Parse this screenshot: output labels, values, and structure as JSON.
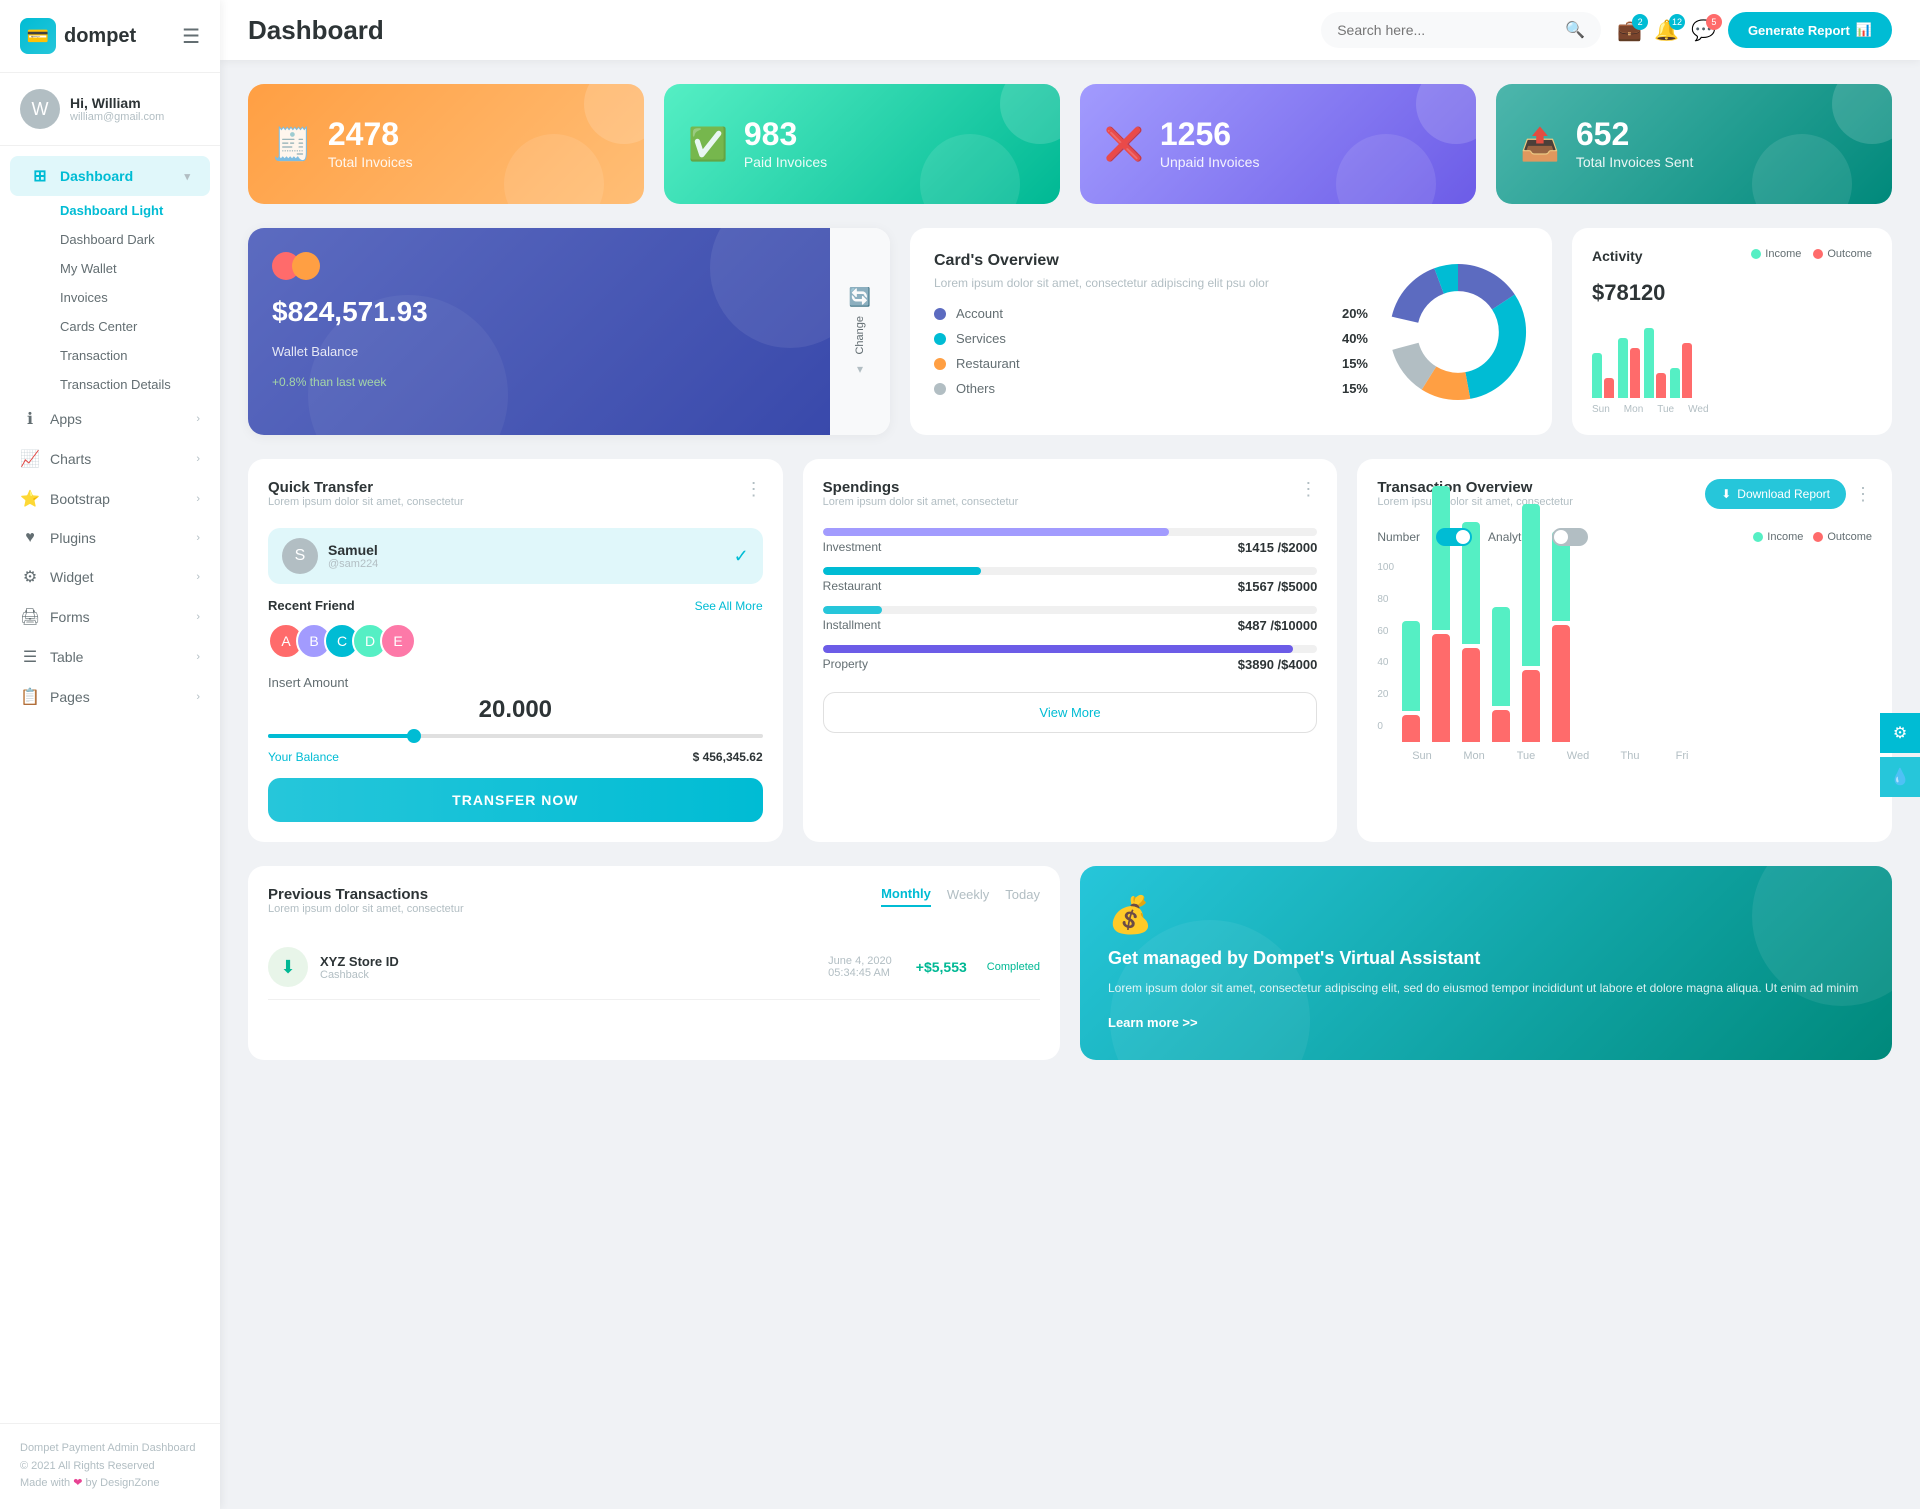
{
  "brand": {
    "name": "dompet",
    "logo_emoji": "💼"
  },
  "header": {
    "title": "Dashboard",
    "search_placeholder": "Search here...",
    "generate_btn": "Generate Report",
    "icons": {
      "wallet_badge": "2",
      "bell_badge": "12",
      "chat_badge": "5"
    }
  },
  "user": {
    "greeting": "Hi, William",
    "email": "william@gmail.com",
    "avatar_letter": "W"
  },
  "sidebar": {
    "dashboard_label": "Dashboard",
    "sub_items": [
      {
        "label": "Dashboard Light",
        "active": true
      },
      {
        "label": "Dashboard Dark",
        "active": false
      },
      {
        "label": "My Wallet",
        "active": false
      },
      {
        "label": "Invoices",
        "active": false
      },
      {
        "label": "Cards Center",
        "active": false
      },
      {
        "label": "Transaction",
        "active": false
      },
      {
        "label": "Transaction Details",
        "active": false
      }
    ],
    "nav_items": [
      {
        "label": "Apps",
        "icon": "ℹ️"
      },
      {
        "label": "Charts",
        "icon": "📊"
      },
      {
        "label": "Bootstrap",
        "icon": "⭐"
      },
      {
        "label": "Plugins",
        "icon": "❤️"
      },
      {
        "label": "Widget",
        "icon": "⚙️"
      },
      {
        "label": "Forms",
        "icon": "🖨️"
      },
      {
        "label": "Table",
        "icon": "☰"
      },
      {
        "label": "Pages",
        "icon": "📋"
      }
    ],
    "footer": {
      "line1": "Dompet Payment Admin Dashboard",
      "line2": "© 2021 All Rights Reserved",
      "line3": "Made with ❤ by DesignZone"
    }
  },
  "stats": [
    {
      "number": "2478",
      "label": "Total Invoices",
      "color": "orange",
      "icon": "🧾"
    },
    {
      "number": "983",
      "label": "Paid Invoices",
      "color": "green",
      "icon": "✅"
    },
    {
      "number": "1256",
      "label": "Unpaid Invoices",
      "color": "purple",
      "icon": "❌"
    },
    {
      "number": "652",
      "label": "Total Invoices Sent",
      "color": "teal",
      "icon": "📤"
    }
  ],
  "wallet_card": {
    "amount": "$824,571.93",
    "label": "Wallet Balance",
    "change": "+0.8% than last week",
    "change_btn": "Change"
  },
  "card_overview": {
    "title": "Card's Overview",
    "subtitle": "Lorem ipsum dolor sit amet, consectetur adipiscing elit psu olor",
    "items": [
      {
        "label": "Account",
        "pct": "20%",
        "color": "#5c6bc0"
      },
      {
        "label": "Services",
        "pct": "40%",
        "color": "#00bcd4"
      },
      {
        "label": "Restaurant",
        "pct": "15%",
        "color": "#ff9f43"
      },
      {
        "label": "Others",
        "pct": "15%",
        "color": "#b2bec3"
      }
    ]
  },
  "activity": {
    "title": "Activity",
    "amount": "$78120",
    "legend_income": "Income",
    "legend_outcome": "Outcome",
    "bars": [
      {
        "day": "Sun",
        "income": 45,
        "outcome": 20
      },
      {
        "day": "Mon",
        "income": 60,
        "outcome": 50
      },
      {
        "day": "Tue",
        "income": 70,
        "outcome": 25
      },
      {
        "day": "Wed",
        "income": 30,
        "outcome": 55
      }
    ]
  },
  "quick_transfer": {
    "title": "Quick Transfer",
    "subtitle": "Lorem ipsum dolor sit amet, consectetur",
    "user": {
      "name": "Samuel",
      "handle": "@sam224",
      "avatar_letter": "S"
    },
    "recent_label": "Recent Friend",
    "see_all": "See All More",
    "friends": [
      "A",
      "B",
      "C",
      "D",
      "E"
    ],
    "insert_label": "Insert Amount",
    "amount": "20.000",
    "balance_label": "Your Balance",
    "balance_amount": "$ 456,345.62",
    "slider_pct": 30,
    "transfer_btn": "TRANSFER NOW"
  },
  "spendings": {
    "title": "Spendings",
    "subtitle": "Lorem ipsum dolor sit amet, consectetur",
    "items": [
      {
        "label": "Investment",
        "amount": "$1415",
        "max": "$2000",
        "pct": 70,
        "color": "#a29bfe"
      },
      {
        "label": "Restaurant",
        "amount": "$1567",
        "max": "$5000",
        "pct": 32,
        "color": "#00bcd4"
      },
      {
        "label": "Installment",
        "amount": "$487",
        "max": "$10000",
        "pct": 12,
        "color": "#26c6da"
      },
      {
        "label": "Property",
        "amount": "$3890",
        "max": "$4000",
        "pct": 95,
        "color": "#6c5ce7"
      }
    ],
    "view_more_btn": "View More"
  },
  "transaction_overview": {
    "title": "Transaction Overview",
    "subtitle": "Lorem ipsum dolor sit amet, consectetur",
    "download_btn": "Download Report",
    "toggle1_label": "Number",
    "toggle2_label": "Analytics",
    "legend_income": "Income",
    "legend_outcome": "Outcome",
    "bars": [
      {
        "day": "Sun",
        "income": 50,
        "outcome": 15
      },
      {
        "day": "Mon",
        "income": 78,
        "outcome": 60
      },
      {
        "day": "Tue",
        "income": 68,
        "outcome": 52
      },
      {
        "day": "Wed",
        "income": 55,
        "outcome": 18
      },
      {
        "day": "Thu",
        "income": 90,
        "outcome": 40
      },
      {
        "day": "Fri",
        "income": 50,
        "outcome": 65
      }
    ],
    "y_labels": [
      "0",
      "20",
      "40",
      "60",
      "80",
      "100"
    ]
  },
  "previous_transactions": {
    "title": "Previous Transactions",
    "subtitle": "Lorem ipsum dolor sit amet, consectetur",
    "tabs": [
      "Monthly",
      "Weekly",
      "Today"
    ],
    "active_tab": "Monthly",
    "rows": [
      {
        "name": "XYZ Store ID",
        "type": "Cashback",
        "date": "June 4, 2020",
        "time": "05:34:45 AM",
        "amount": "+$5,553",
        "status": "Completed",
        "icon": "⬇️",
        "icon_color": "#00b894"
      }
    ]
  },
  "virtual_assistant": {
    "title": "Get managed by Dompet's Virtual Assistant",
    "desc": "Lorem ipsum dolor sit amet, consectetur adipiscing elit, sed do eiusmod tempor incididunt ut labore et dolore magna aliqua. Ut enim ad minim",
    "learn_more": "Learn more >>",
    "icon": "💰"
  }
}
